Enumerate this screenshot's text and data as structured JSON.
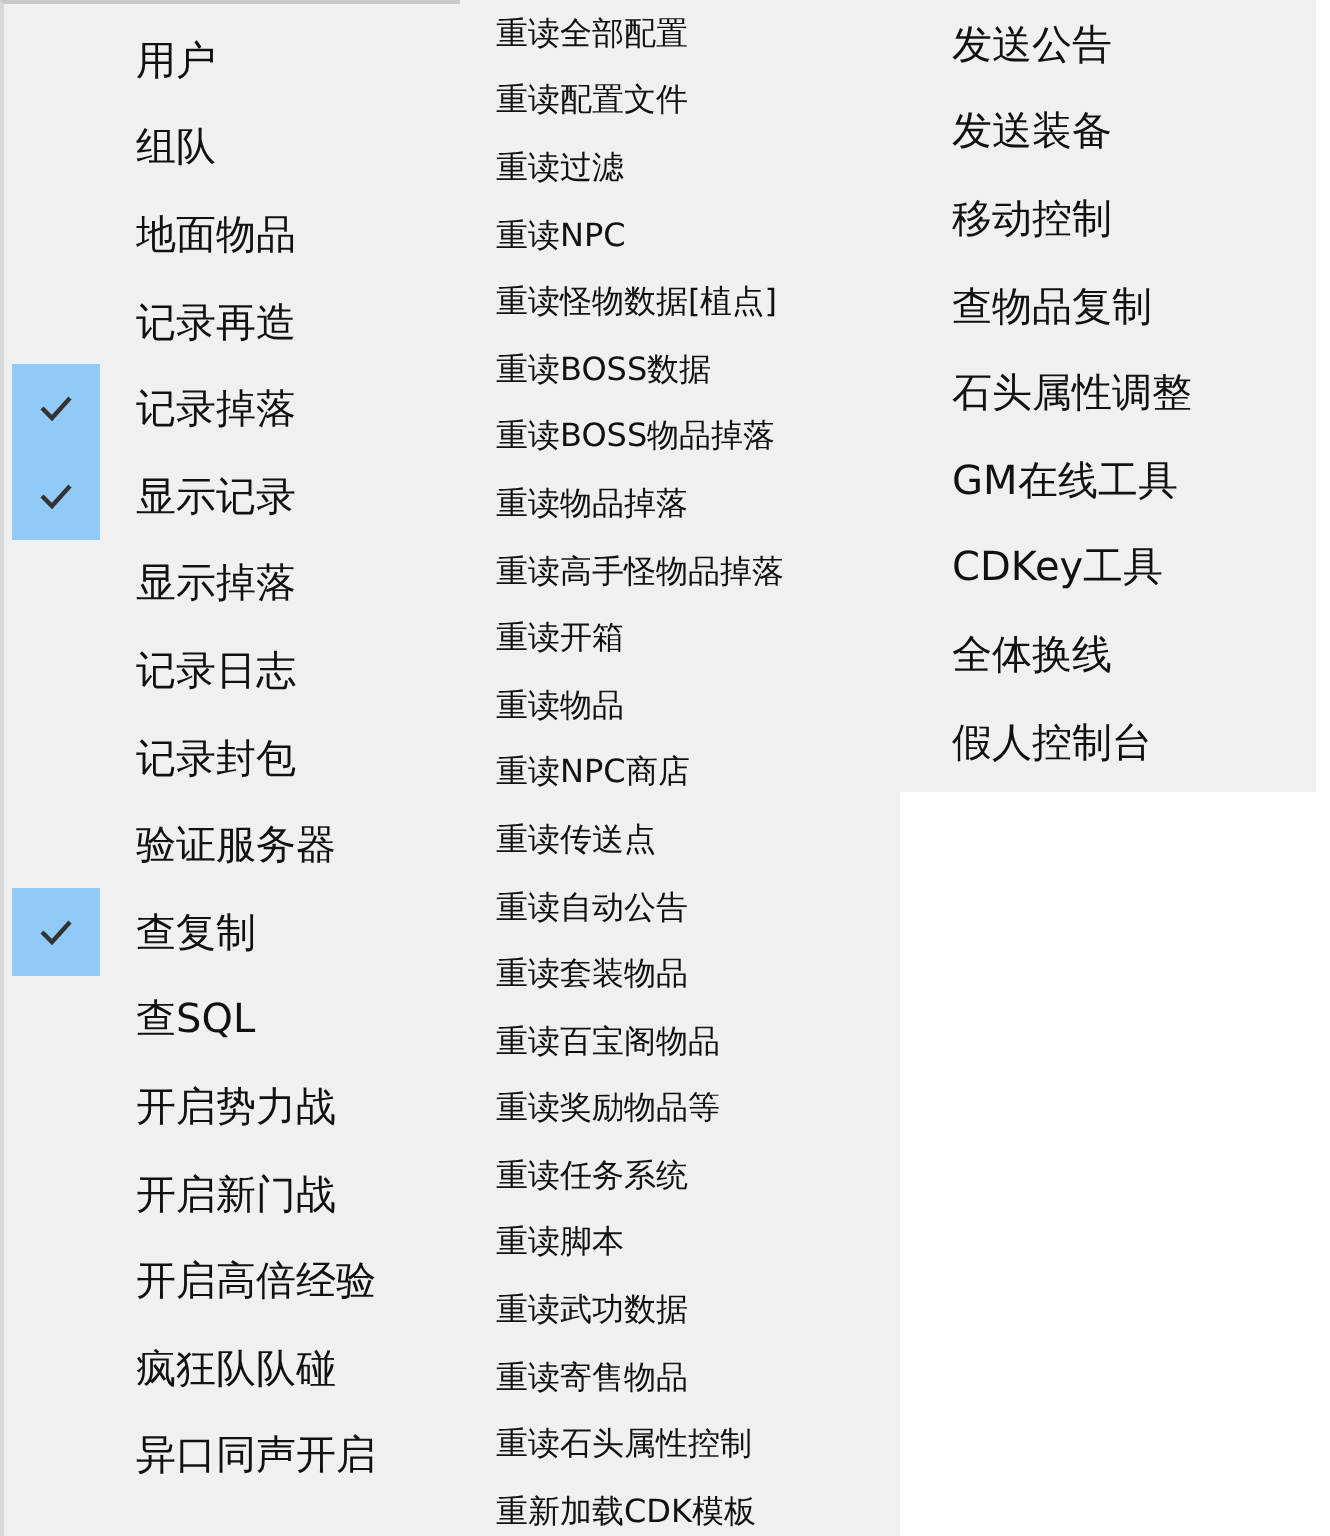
{
  "menus": [
    {
      "items": [
        {
          "label": "用户",
          "checked": false
        },
        {
          "label": "组队",
          "checked": false
        },
        {
          "label": "地面物品",
          "checked": false
        },
        {
          "label": "记录再造",
          "checked": false
        },
        {
          "label": "记录掉落",
          "checked": true
        },
        {
          "label": "显示记录",
          "checked": true
        },
        {
          "label": "显示掉落",
          "checked": false
        },
        {
          "label": "记录日志",
          "checked": false
        },
        {
          "label": "记录封包",
          "checked": false
        },
        {
          "label": "验证服务器",
          "checked": false
        },
        {
          "label": "查复制",
          "checked": true
        },
        {
          "label": "查SQL",
          "checked": false
        },
        {
          "label": "开启势力战",
          "checked": false
        },
        {
          "label": "开启新门战",
          "checked": false
        },
        {
          "label": "开启高倍经验",
          "checked": false
        },
        {
          "label": "疯狂队队碰",
          "checked": false
        },
        {
          "label": "异口同声开启",
          "checked": false
        }
      ]
    },
    {
      "items": [
        {
          "label": "重读全部配置"
        },
        {
          "label": "重读配置文件"
        },
        {
          "label": "重读过滤"
        },
        {
          "label": "重读NPC"
        },
        {
          "label": "重读怪物数据[植点]"
        },
        {
          "label": "重读BOSS数据"
        },
        {
          "label": "重读BOSS物品掉落"
        },
        {
          "label": "重读物品掉落"
        },
        {
          "label": "重读高手怪物品掉落"
        },
        {
          "label": "重读开箱"
        },
        {
          "label": "重读物品"
        },
        {
          "label": "重读NPC商店"
        },
        {
          "label": "重读传送点"
        },
        {
          "label": "重读自动公告"
        },
        {
          "label": "重读套装物品"
        },
        {
          "label": "重读百宝阁物品"
        },
        {
          "label": "重读奖励物品等"
        },
        {
          "label": "重读任务系统"
        },
        {
          "label": "重读脚本"
        },
        {
          "label": "重读武功数据"
        },
        {
          "label": "重读寄售物品"
        },
        {
          "label": "重读石头属性控制"
        },
        {
          "label": "重新加载CDK模板"
        }
      ]
    },
    {
      "items": [
        {
          "label": "发送公告"
        },
        {
          "label": "发送装备"
        },
        {
          "label": "移动控制"
        },
        {
          "label": "查物品复制"
        },
        {
          "label": "石头属性调整"
        },
        {
          "label": "GM在线工具"
        },
        {
          "label": "CDKey工具"
        },
        {
          "label": "全体换线"
        },
        {
          "label": "假人控制台"
        }
      ]
    }
  ]
}
